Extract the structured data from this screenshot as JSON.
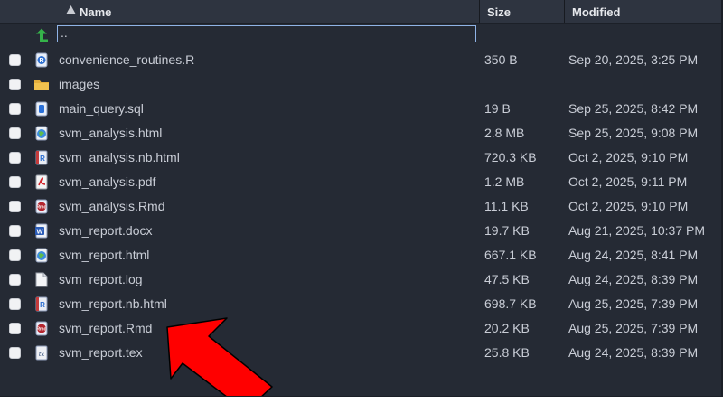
{
  "columns": {
    "name": "Name",
    "size": "Size",
    "modified": "Modified"
  },
  "parent_dir": {
    "label": "..",
    "icon": "up-arrow-icon"
  },
  "files": [
    {
      "name": "convenience_routines.R",
      "size": "350 B",
      "modified": "Sep 20, 2025, 3:25 PM",
      "icon": "r-script-icon"
    },
    {
      "name": "images",
      "size": "",
      "modified": "",
      "icon": "folder-icon"
    },
    {
      "name": "main_query.sql",
      "size": "19 B",
      "modified": "Sep 25, 2025, 8:42 PM",
      "icon": "sql-file-icon"
    },
    {
      "name": "svm_analysis.html",
      "size": "2.8 MB",
      "modified": "Sep 25, 2025, 9:08 PM",
      "icon": "html-file-icon"
    },
    {
      "name": "svm_analysis.nb.html",
      "size": "720.3 KB",
      "modified": "Oct 2, 2025, 9:10 PM",
      "icon": "r-notebook-icon"
    },
    {
      "name": "svm_analysis.pdf",
      "size": "1.2 MB",
      "modified": "Oct 2, 2025, 9:11 PM",
      "icon": "pdf-file-icon"
    },
    {
      "name": "svm_analysis.Rmd",
      "size": "11.1 KB",
      "modified": "Oct 2, 2025, 9:10 PM",
      "icon": "rmd-file-icon"
    },
    {
      "name": "svm_report.docx",
      "size": "19.7 KB",
      "modified": "Aug 21, 2025, 10:37 PM",
      "icon": "word-file-icon"
    },
    {
      "name": "svm_report.html",
      "size": "667.1 KB",
      "modified": "Aug 24, 2025, 8:41 PM",
      "icon": "html-file-icon"
    },
    {
      "name": "svm_report.log",
      "size": "47.5 KB",
      "modified": "Aug 24, 2025, 8:39 PM",
      "icon": "text-file-icon"
    },
    {
      "name": "svm_report.nb.html",
      "size": "698.7 KB",
      "modified": "Aug 25, 2025, 7:39 PM",
      "icon": "r-notebook-icon"
    },
    {
      "name": "svm_report.Rmd",
      "size": "20.2 KB",
      "modified": "Aug 25, 2025, 7:39 PM",
      "icon": "rmd-file-icon"
    },
    {
      "name": "svm_report.tex",
      "size": "25.8 KB",
      "modified": "Aug 24, 2025, 8:39 PM",
      "icon": "tex-file-icon"
    }
  ],
  "annotation": {
    "icon": "red-arrow-icon",
    "color": "#ff0000",
    "points_to": "svm_report.Rmd"
  },
  "colors": {
    "pane_bg": "#252a34",
    "header_bg": "#2e3440",
    "text": "#c9cdd6",
    "focus": "#8fb3e6"
  }
}
